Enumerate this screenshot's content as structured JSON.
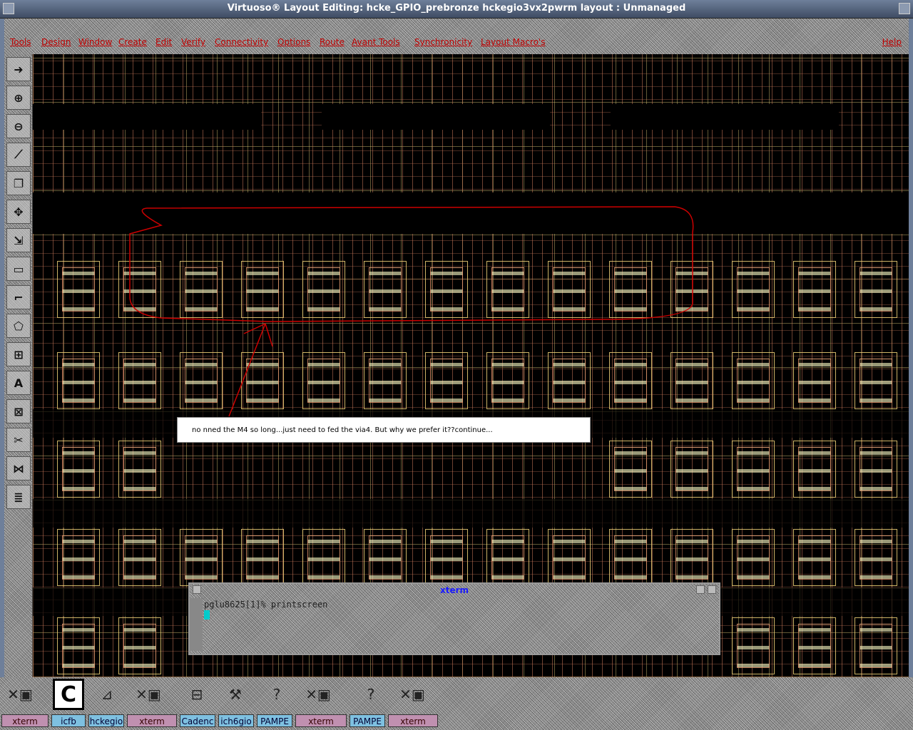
{
  "window": {
    "title": "Virtuoso® Layout Editing: hcke_GPIO_prebronze hckegio3vx2pwrm layout : Unmanaged"
  },
  "menubar": {
    "items": [
      "Tools",
      "Design",
      "Window",
      "Create",
      "Edit",
      "Verify",
      "Connectivity",
      "Options",
      "Route",
      "Avant Tools",
      "Synchronicity",
      "Layout Macro's"
    ],
    "help": "Help"
  },
  "toolbox": {
    "icons": [
      "pointer-icon",
      "zoom-in-icon",
      "zoom-out-icon",
      "ruler-icon",
      "copy-icon",
      "move-icon",
      "stretch-icon",
      "rectangle-icon",
      "path-icon",
      "polygon-icon",
      "instance-icon",
      "label-icon",
      "via-icon",
      "cut-icon",
      "merge-icon",
      "property-icon"
    ]
  },
  "annotation": {
    "text": "no nned the M4 so long...just need to fed the via4. But why we prefer it??continue...",
    "color": "#cc0000"
  },
  "xterm": {
    "title": "xterm",
    "prompt": "pglu8625[1]% printscreen"
  },
  "taskbar": {
    "tabs": [
      {
        "label": "xterm",
        "style": "pink"
      },
      {
        "label": "icfb",
        "style": "light"
      },
      {
        "label": "hckegio",
        "style": "light"
      },
      {
        "label": "xterm",
        "style": "pink"
      },
      {
        "label": "Cadenc",
        "style": "light"
      },
      {
        "label": "ich6gio",
        "style": "light"
      },
      {
        "label": "PAMPE",
        "style": "light"
      },
      {
        "label": "xterm",
        "style": "pink"
      },
      {
        "label": "PAMPE",
        "style": "light"
      },
      {
        "label": "xterm",
        "style": "pink"
      }
    ]
  },
  "colors": {
    "titlebar": "#4a5770",
    "menu_text": "#c00000",
    "metal_yellow": "#f0d278",
    "metal_orange": "#c8785a",
    "annotation_stroke": "#cc0000",
    "xterm_title": "#1a1aff"
  }
}
